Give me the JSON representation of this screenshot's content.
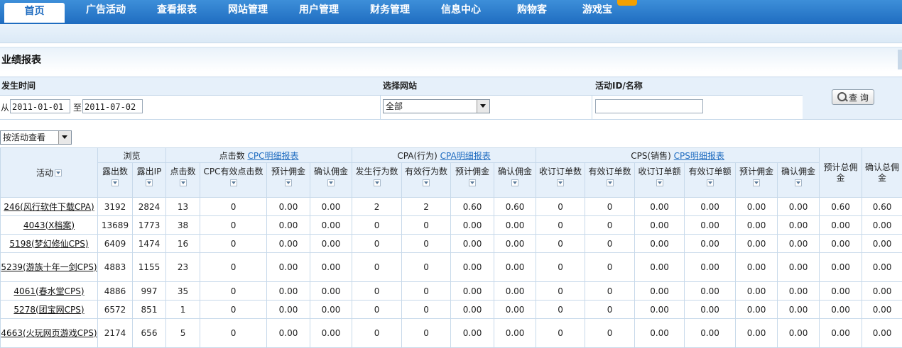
{
  "nav": {
    "tabs": [
      "首页",
      "广告活动",
      "查看报表",
      "网站管理",
      "用户管理",
      "财务管理",
      "信息中心",
      "购物客",
      "游戏宝"
    ],
    "active_index": 0
  },
  "page_title": "业绩报表",
  "filter": {
    "time_label": "发生时间",
    "from_label": "从",
    "from_value": "2011-01-01",
    "to_label": "至",
    "to_value": "2011-07-02",
    "site_label": "选择网站",
    "site_value": "全部",
    "activity_label": "活动ID/名称",
    "activity_value": "",
    "query_label": "查 询"
  },
  "view_select": "按活动查看",
  "table": {
    "activity_header": "活动",
    "group_browse": "浏览",
    "group_click": "点击数",
    "group_click_link": "CPC明细报表",
    "group_cpa": "CPA(行为)",
    "group_cpa_link": "CPA明细报表",
    "group_cps": "CPS(销售)",
    "group_cps_link": "CPS明细报表",
    "est_total": "预计总佣金",
    "confirm_total": "确认总佣金",
    "subheaders": [
      "露出数",
      "露出IP",
      "点击数",
      "CPC有效点击数",
      "预计佣金",
      "确认佣金",
      "发生行为数",
      "有效行为数",
      "预计佣金",
      "确认佣金",
      "收订订单数",
      "有效订单数",
      "收订订单额",
      "有效订单额",
      "预计佣金",
      "确认佣金"
    ],
    "rows": [
      {
        "activity": "246(风行软件下载CPA)",
        "tall": false,
        "values": [
          "3192",
          "2824",
          "13",
          "0",
          "0.00",
          "0.00",
          "2",
          "2",
          "0.60",
          "0.60",
          "0",
          "0",
          "0.00",
          "0.00",
          "0.00",
          "0.00",
          "0.60",
          "0.60"
        ]
      },
      {
        "activity": "4043(X档案)",
        "tall": false,
        "values": [
          "13689",
          "1773",
          "38",
          "0",
          "0.00",
          "0.00",
          "0",
          "0",
          "0.00",
          "0.00",
          "0",
          "0",
          "0.00",
          "0.00",
          "0.00",
          "0.00",
          "0.00",
          "0.00"
        ]
      },
      {
        "activity": "5198(梦幻修仙CPS)",
        "tall": false,
        "values": [
          "6409",
          "1474",
          "16",
          "0",
          "0.00",
          "0.00",
          "0",
          "0",
          "0.00",
          "0.00",
          "0",
          "0",
          "0.00",
          "0.00",
          "0.00",
          "0.00",
          "0.00",
          "0.00"
        ]
      },
      {
        "activity": "5239(游族十年一剑CPS)",
        "tall": true,
        "values": [
          "4883",
          "1155",
          "23",
          "0",
          "0.00",
          "0.00",
          "0",
          "0",
          "0.00",
          "0.00",
          "0",
          "0",
          "0.00",
          "0.00",
          "0.00",
          "0.00",
          "0.00",
          "0.00"
        ]
      },
      {
        "activity": "4061(春水堂CPS)",
        "tall": false,
        "values": [
          "4886",
          "997",
          "35",
          "0",
          "0.00",
          "0.00",
          "0",
          "0",
          "0.00",
          "0.00",
          "0",
          "0",
          "0.00",
          "0.00",
          "0.00",
          "0.00",
          "0.00",
          "0.00"
        ]
      },
      {
        "activity": "5278(团宝网CPS)",
        "tall": false,
        "values": [
          "6572",
          "851",
          "1",
          "0",
          "0.00",
          "0.00",
          "0",
          "0",
          "0.00",
          "0.00",
          "0",
          "0",
          "0.00",
          "0.00",
          "0.00",
          "0.00",
          "0.00",
          "0.00"
        ]
      },
      {
        "activity": "4663(火玩网页游戏CPS)",
        "tall": true,
        "values": [
          "2174",
          "656",
          "5",
          "0",
          "0.00",
          "0.00",
          "0",
          "0",
          "0.00",
          "0.00",
          "0",
          "0",
          "0.00",
          "0.00",
          "0.00",
          "0.00",
          "0.00",
          "0.00"
        ]
      }
    ]
  }
}
